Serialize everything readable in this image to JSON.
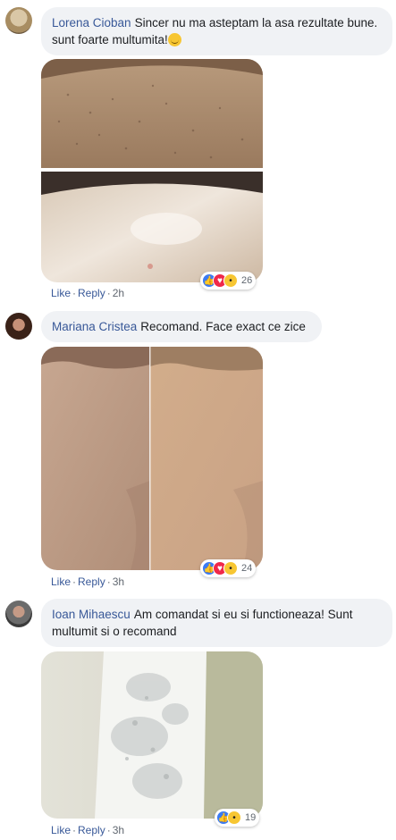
{
  "comments": [
    {
      "author": "Lorena Cioban",
      "text": "Sincer nu ma asteptam la asa rezultate bune. sunt foarte multumita!",
      "emoji": "smiling-face-emoji",
      "like_label": "Like",
      "reply_label": "Reply",
      "time": "2h",
      "reaction_count": "26",
      "reactions": [
        "like-icon",
        "love-icon",
        "wow-icon"
      ]
    },
    {
      "author": "Mariana Cristea",
      "text": "Recomand. Face exact ce zice",
      "like_label": "Like",
      "reply_label": "Reply",
      "time": "3h",
      "reaction_count": "24",
      "reactions": [
        "like-icon",
        "love-icon",
        "wow-icon"
      ]
    },
    {
      "author": "Ioan Mihaescu",
      "text": "Am comandat si eu si functioneaza! Sunt multumit si o recomand",
      "like_label": "Like",
      "reply_label": "Reply",
      "time": "3h",
      "reaction_count": "19",
      "reactions": [
        "like-icon",
        "wow-icon"
      ]
    }
  ],
  "separator": "·",
  "colors": {
    "link": "#385898",
    "bubble": "#f0f2f5",
    "like": "#3b7bf3",
    "love": "#f0284a",
    "wow": "#f7c632"
  }
}
